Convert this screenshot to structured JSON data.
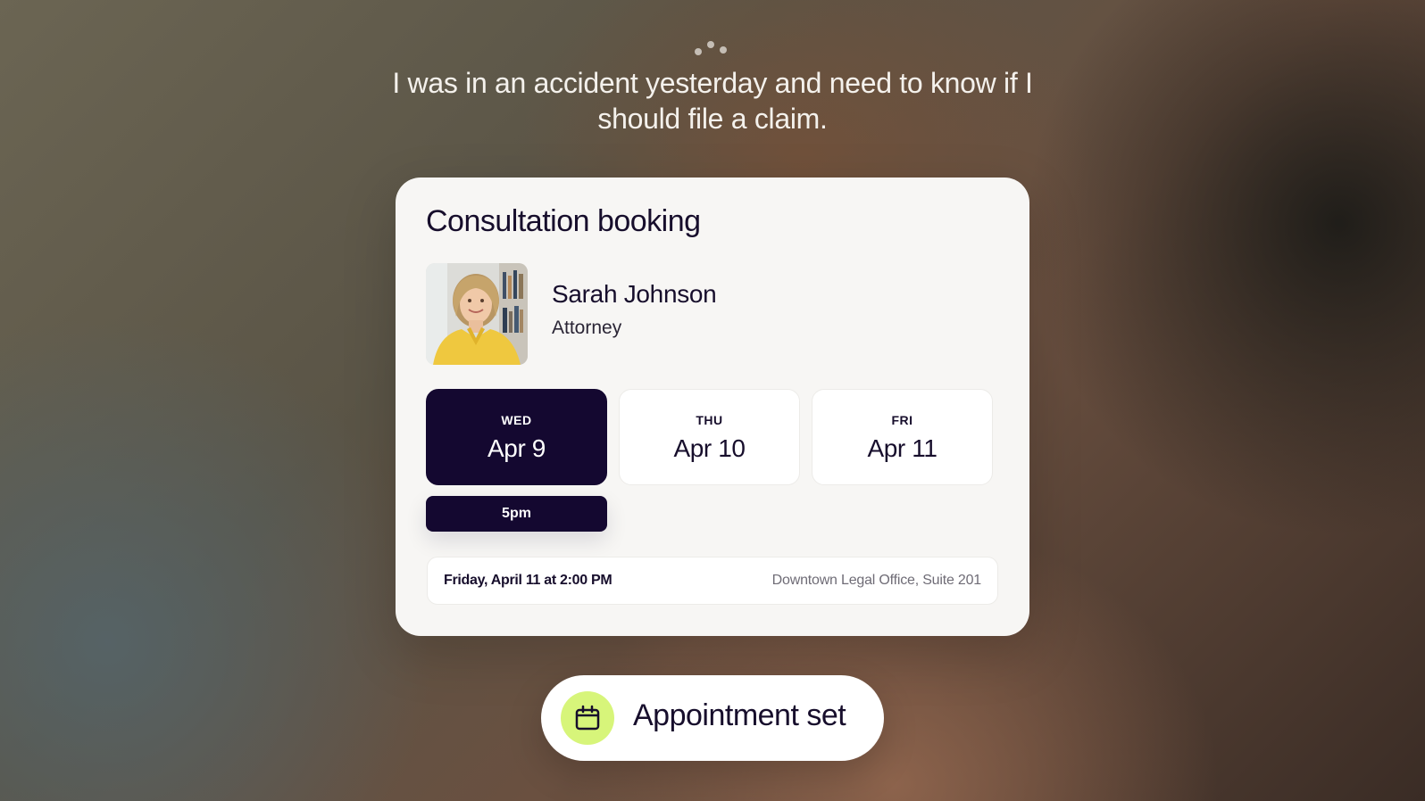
{
  "header": {
    "loading_indicator": "typing-dots",
    "prompt_text": "I was in an accident yesterday and need to know if I should file a claim."
  },
  "booking_card": {
    "title": "Consultation booking",
    "attorney": {
      "name": "Sarah Johnson",
      "role": "Attorney"
    },
    "dates": [
      {
        "dow": "WED",
        "date": "Apr 9",
        "selected": true
      },
      {
        "dow": "THU",
        "date": "Apr 10",
        "selected": false
      },
      {
        "dow": "FRI",
        "date": "Apr 11",
        "selected": false
      }
    ],
    "time_slot": "5pm",
    "summary": {
      "when": "Friday, April 11 at 2:00 PM",
      "where": "Downtown Legal Office, Suite 201"
    }
  },
  "toast": {
    "icon": "calendar-icon",
    "label": "Appointment set"
  },
  "colors": {
    "primary_dark": "#140830",
    "card_bg": "#f7f6f4",
    "accent_lime": "#d7f57a",
    "muted_text": "#6f6c76"
  }
}
